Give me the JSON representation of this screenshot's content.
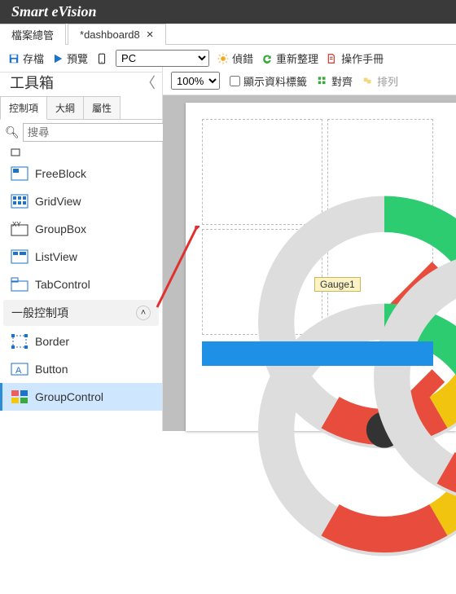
{
  "app_title": "Smart eVision",
  "tabs": {
    "file": "檔案總管",
    "doc": "*dashboard8"
  },
  "toolbar": {
    "save": "存檔",
    "preview": "預覽",
    "device_selected": "PC",
    "debug": "偵錯",
    "refresh": "重新整理",
    "manual": "操作手冊"
  },
  "toolbox": {
    "title": "工具箱",
    "tabs": {
      "controls": "控制項",
      "outline": "大綱",
      "properties": "屬性"
    },
    "search_placeholder": "搜尋",
    "items": {
      "freeblock": "FreeBlock",
      "gridview": "GridView",
      "groupbox": "GroupBox",
      "listview": "ListView",
      "tabcontrol": "TabControl",
      "section_general": "一般控制項",
      "border": "Border",
      "button": "Button",
      "groupcontrol": "GroupControl"
    }
  },
  "design": {
    "zoom_selected": "100%",
    "show_data_labels": "顯示資料標籤",
    "align": "對齊",
    "arrange": "排列",
    "gauge_label": "Gauge1"
  }
}
